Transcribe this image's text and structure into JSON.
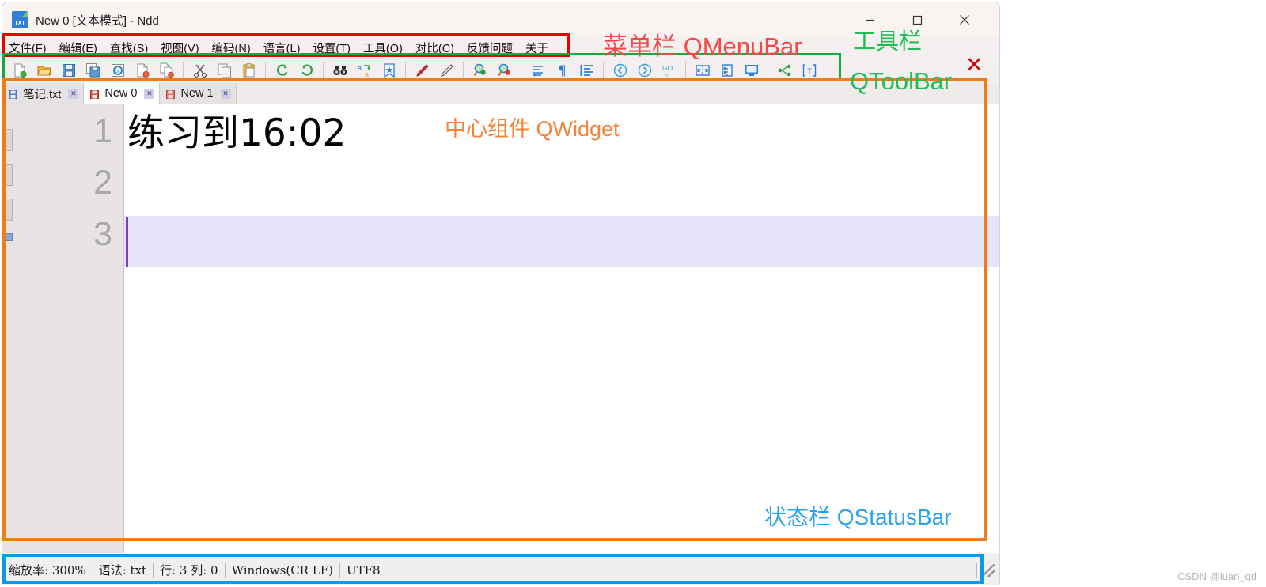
{
  "window": {
    "title": "New 0 [文本模式] - Ndd",
    "icon_name": "txt-file-icon",
    "icon_label": "TXT",
    "controls": {
      "minimize": "—",
      "maximize": "☐",
      "close": "✕"
    }
  },
  "menubar": {
    "items": [
      {
        "label": "文件(F)",
        "mnemonic": "F"
      },
      {
        "label": "编辑(E)",
        "mnemonic": "E"
      },
      {
        "label": "查找(S)",
        "mnemonic": "S"
      },
      {
        "label": "视图(V)",
        "mnemonic": "V"
      },
      {
        "label": "编码(N)",
        "mnemonic": "N"
      },
      {
        "label": "语言(L)",
        "mnemonic": "L"
      },
      {
        "label": "设置(T)",
        "mnemonic": "T"
      },
      {
        "label": "工具(O)",
        "mnemonic": "O"
      },
      {
        "label": "对比(C)",
        "mnemonic": "C"
      },
      {
        "label": "反馈问题",
        "mnemonic": ""
      },
      {
        "label": "关于",
        "mnemonic": ""
      }
    ]
  },
  "toolbar": {
    "groups": [
      [
        "new-file-icon",
        "open-folder-icon",
        "save-icon",
        "save-all-icon",
        "save-as-icon",
        "close-file-icon",
        "close-all-icon"
      ],
      [
        "cut-icon",
        "copy-icon",
        "paste-icon"
      ],
      [
        "undo-icon",
        "redo-icon"
      ],
      [
        "find-icon",
        "replace-icon",
        "bookmark-icon"
      ],
      [
        "mark-icon",
        "unmark-icon"
      ],
      [
        "zoom-in-icon",
        "zoom-out-icon"
      ],
      [
        "show-whitespace-icon",
        "show-paragraph-icon",
        "word-wrap-icon"
      ],
      [
        "nav-back-icon",
        "nav-forward-icon",
        "goto-line-icon"
      ],
      [
        "split-horizontal-icon",
        "split-vertical-icon",
        "fullscreen-icon"
      ],
      [
        "code-map-icon",
        "text-mode-icon"
      ]
    ]
  },
  "tabs": [
    {
      "label": "笔记.txt",
      "icon": "saved-file-icon",
      "active": false,
      "close": "✕"
    },
    {
      "label": "New 0",
      "icon": "unsaved-file-icon",
      "active": true,
      "close": "✕"
    },
    {
      "label": "New 1",
      "icon": "unsaved-file-icon",
      "active": false,
      "close": "✕"
    }
  ],
  "editor": {
    "line_numbers": [
      "1",
      "2",
      "3"
    ],
    "lines": [
      "练习到16:02",
      "",
      ""
    ],
    "current_line": 3,
    "caret_column": 0
  },
  "statusbar": {
    "zoom_label": "缩放率: 300%",
    "syntax_label": "语法: txt",
    "position_label": "行: 3 列: 0",
    "eol_label": "Windows(CR LF)",
    "encoding_label": "UTF8"
  },
  "annotations": {
    "menubar": "菜单栏 QMenuBar",
    "toolbar_line1": "工具栏",
    "toolbar_line2": "QToolBar",
    "central": "中心组件 QWidget",
    "statusbar": "状态栏 QStatusBar",
    "cross_mark": "✕"
  },
  "watermark": "CSDN @luan_qd",
  "colors": {
    "menubar_box": "#ee0000",
    "toolbar_box": "#17a93a",
    "central_box": "#f07c18",
    "statusbar_box": "#0b9ae8",
    "menubar_text": "#f4494c",
    "toolbar_text": "#20bf56",
    "central_text": "#f5833a",
    "statusbar_text": "#2aa3ef",
    "caret": "#7d3fb5",
    "current_line": "#e6e4f8"
  }
}
